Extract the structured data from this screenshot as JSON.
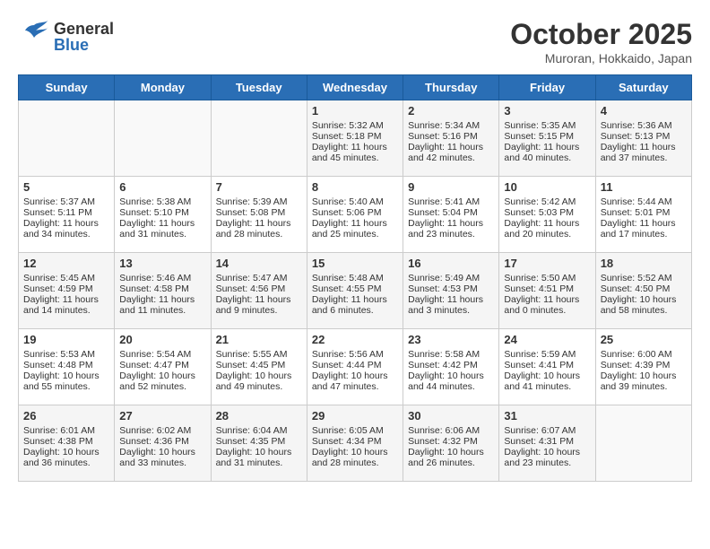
{
  "header": {
    "logo": {
      "general": "General",
      "blue": "Blue"
    },
    "title": "October 2025",
    "location": "Muroran, Hokkaido, Japan"
  },
  "days_of_week": [
    "Sunday",
    "Monday",
    "Tuesday",
    "Wednesday",
    "Thursday",
    "Friday",
    "Saturday"
  ],
  "weeks": [
    [
      {
        "day": "",
        "content": ""
      },
      {
        "day": "",
        "content": ""
      },
      {
        "day": "",
        "content": ""
      },
      {
        "day": "1",
        "content": "Sunrise: 5:32 AM\nSunset: 5:18 PM\nDaylight: 11 hours\nand 45 minutes."
      },
      {
        "day": "2",
        "content": "Sunrise: 5:34 AM\nSunset: 5:16 PM\nDaylight: 11 hours\nand 42 minutes."
      },
      {
        "day": "3",
        "content": "Sunrise: 5:35 AM\nSunset: 5:15 PM\nDaylight: 11 hours\nand 40 minutes."
      },
      {
        "day": "4",
        "content": "Sunrise: 5:36 AM\nSunset: 5:13 PM\nDaylight: 11 hours\nand 37 minutes."
      }
    ],
    [
      {
        "day": "5",
        "content": "Sunrise: 5:37 AM\nSunset: 5:11 PM\nDaylight: 11 hours\nand 34 minutes."
      },
      {
        "day": "6",
        "content": "Sunrise: 5:38 AM\nSunset: 5:10 PM\nDaylight: 11 hours\nand 31 minutes."
      },
      {
        "day": "7",
        "content": "Sunrise: 5:39 AM\nSunset: 5:08 PM\nDaylight: 11 hours\nand 28 minutes."
      },
      {
        "day": "8",
        "content": "Sunrise: 5:40 AM\nSunset: 5:06 PM\nDaylight: 11 hours\nand 25 minutes."
      },
      {
        "day": "9",
        "content": "Sunrise: 5:41 AM\nSunset: 5:04 PM\nDaylight: 11 hours\nand 23 minutes."
      },
      {
        "day": "10",
        "content": "Sunrise: 5:42 AM\nSunset: 5:03 PM\nDaylight: 11 hours\nand 20 minutes."
      },
      {
        "day": "11",
        "content": "Sunrise: 5:44 AM\nSunset: 5:01 PM\nDaylight: 11 hours\nand 17 minutes."
      }
    ],
    [
      {
        "day": "12",
        "content": "Sunrise: 5:45 AM\nSunset: 4:59 PM\nDaylight: 11 hours\nand 14 minutes."
      },
      {
        "day": "13",
        "content": "Sunrise: 5:46 AM\nSunset: 4:58 PM\nDaylight: 11 hours\nand 11 minutes."
      },
      {
        "day": "14",
        "content": "Sunrise: 5:47 AM\nSunset: 4:56 PM\nDaylight: 11 hours\nand 9 minutes."
      },
      {
        "day": "15",
        "content": "Sunrise: 5:48 AM\nSunset: 4:55 PM\nDaylight: 11 hours\nand 6 minutes."
      },
      {
        "day": "16",
        "content": "Sunrise: 5:49 AM\nSunset: 4:53 PM\nDaylight: 11 hours\nand 3 minutes."
      },
      {
        "day": "17",
        "content": "Sunrise: 5:50 AM\nSunset: 4:51 PM\nDaylight: 11 hours\nand 0 minutes."
      },
      {
        "day": "18",
        "content": "Sunrise: 5:52 AM\nSunset: 4:50 PM\nDaylight: 10 hours\nand 58 minutes."
      }
    ],
    [
      {
        "day": "19",
        "content": "Sunrise: 5:53 AM\nSunset: 4:48 PM\nDaylight: 10 hours\nand 55 minutes."
      },
      {
        "day": "20",
        "content": "Sunrise: 5:54 AM\nSunset: 4:47 PM\nDaylight: 10 hours\nand 52 minutes."
      },
      {
        "day": "21",
        "content": "Sunrise: 5:55 AM\nSunset: 4:45 PM\nDaylight: 10 hours\nand 49 minutes."
      },
      {
        "day": "22",
        "content": "Sunrise: 5:56 AM\nSunset: 4:44 PM\nDaylight: 10 hours\nand 47 minutes."
      },
      {
        "day": "23",
        "content": "Sunrise: 5:58 AM\nSunset: 4:42 PM\nDaylight: 10 hours\nand 44 minutes."
      },
      {
        "day": "24",
        "content": "Sunrise: 5:59 AM\nSunset: 4:41 PM\nDaylight: 10 hours\nand 41 minutes."
      },
      {
        "day": "25",
        "content": "Sunrise: 6:00 AM\nSunset: 4:39 PM\nDaylight: 10 hours\nand 39 minutes."
      }
    ],
    [
      {
        "day": "26",
        "content": "Sunrise: 6:01 AM\nSunset: 4:38 PM\nDaylight: 10 hours\nand 36 minutes."
      },
      {
        "day": "27",
        "content": "Sunrise: 6:02 AM\nSunset: 4:36 PM\nDaylight: 10 hours\nand 33 minutes."
      },
      {
        "day": "28",
        "content": "Sunrise: 6:04 AM\nSunset: 4:35 PM\nDaylight: 10 hours\nand 31 minutes."
      },
      {
        "day": "29",
        "content": "Sunrise: 6:05 AM\nSunset: 4:34 PM\nDaylight: 10 hours\nand 28 minutes."
      },
      {
        "day": "30",
        "content": "Sunrise: 6:06 AM\nSunset: 4:32 PM\nDaylight: 10 hours\nand 26 minutes."
      },
      {
        "day": "31",
        "content": "Sunrise: 6:07 AM\nSunset: 4:31 PM\nDaylight: 10 hours\nand 23 minutes."
      },
      {
        "day": "",
        "content": ""
      }
    ]
  ]
}
